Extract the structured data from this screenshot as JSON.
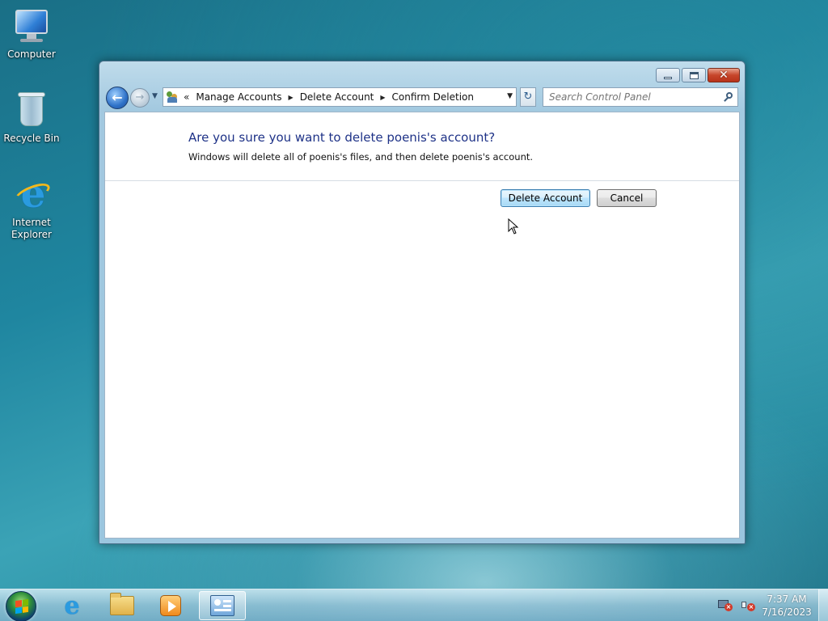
{
  "desktop": {
    "icons": [
      {
        "label": "Computer"
      },
      {
        "label": "Recycle Bin"
      },
      {
        "label": "Internet Explorer"
      }
    ]
  },
  "window": {
    "breadcrumb": [
      "Manage Accounts",
      "Delete Account",
      "Confirm Deletion"
    ],
    "search_placeholder": "Search Control Panel",
    "question": "Are you sure you want to delete poenis's account?",
    "explanation": "Windows will delete all of poenis's files, and then delete poenis's account.",
    "buttons": {
      "delete": "Delete Account",
      "cancel": "Cancel"
    }
  },
  "taskbar": {
    "items": [
      "start-orb",
      "internet-explorer",
      "windows-explorer",
      "media-player",
      "control-panel"
    ],
    "clock": {
      "time": "7:37 AM",
      "date": "7/16/2023"
    }
  }
}
